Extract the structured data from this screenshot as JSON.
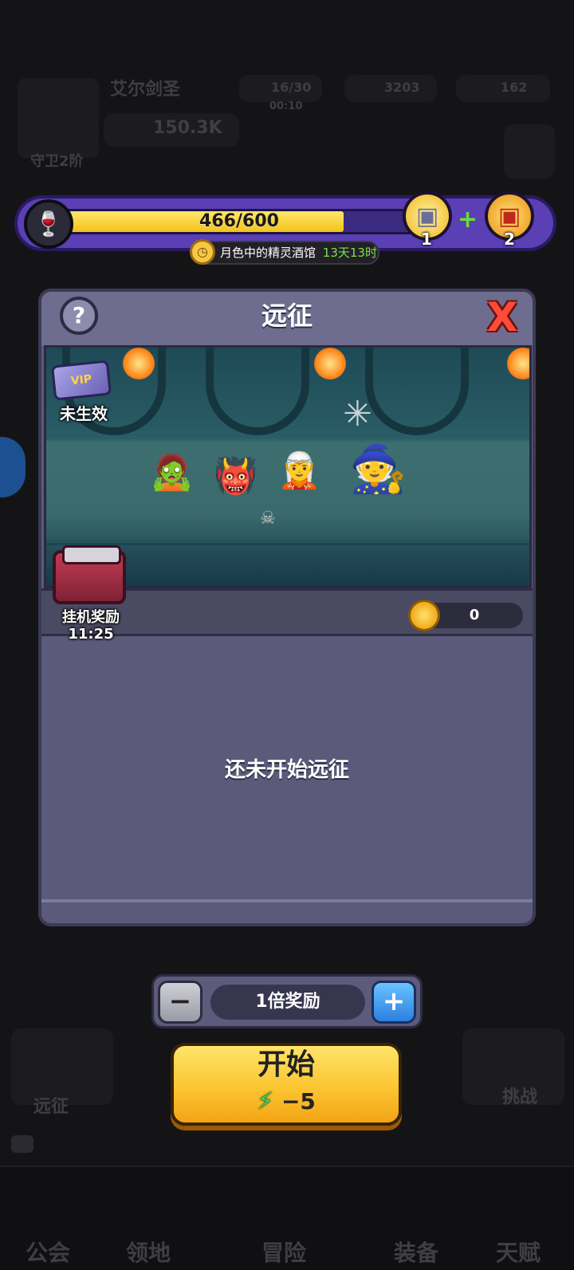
{
  "player": {
    "name": "艾尔剑圣",
    "rank": "守卫2阶",
    "power": "150.3K"
  },
  "resources": {
    "energy": "16/30",
    "energy_timer": "00:10",
    "gems": "3203",
    "gold": "162"
  },
  "event_bar": {
    "progress_text": "466/600",
    "progress_fraction": 0.7767,
    "event_name": "月色中的精灵酒馆",
    "event_time_left": "13天13时",
    "chest_silver_count": "1",
    "chest_gold_count": "2"
  },
  "dialog": {
    "title": "远征",
    "help_label": "?",
    "close_label": "X",
    "vip_card_text": "VIP",
    "vip_status": "未生效",
    "idle_reward_label": "挂机奖励",
    "idle_reward_time": "11:25",
    "coin_value": "0",
    "empty_message": "还未开始远征"
  },
  "controls": {
    "minus_label": "−",
    "plus_label": "+",
    "multiplier_label": "1倍奖励",
    "start_label": "开始",
    "energy_cost": "−5"
  },
  "bottom_nav": {
    "expedition": "远征",
    "challenge": "挑战",
    "guild": "公会",
    "territory": "领地",
    "adventure": "冒险",
    "equipment": "装备",
    "talent": "天赋"
  },
  "colors": {
    "bar_fill": "#f3c21b",
    "frame_purple": "#5a3fb5",
    "dialog_bg": "#5b5a7a",
    "start_button": "#fbc531",
    "plus_button": "#2b7fe0"
  }
}
